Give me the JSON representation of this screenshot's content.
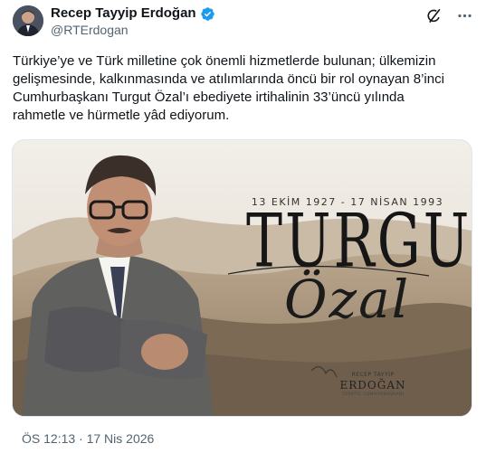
{
  "author": {
    "display_name": "Recep Tayyip Erdoğan",
    "handle": "@RTErdogan",
    "verified_icon": "verified-badge-icon"
  },
  "tweet": {
    "text_lines": [
      "Türkiye’ye ve Türk milletine çok önemli hizmetlerde bulunan; ülkemizin",
      "gelişmesinde, kalkınmasında ve atılımlarında öncü bir rol oynayan 8’inci",
      "Cumhurbaşkanı Turgut Özal’ı ebediyete irtihalinin 33’üncü yılında",
      "rahmetle ve hürmetle yâd ediyorum."
    ],
    "timestamp": "ÖS 12:13 · 17 Nis 2026"
  },
  "media": {
    "dates": "13 EKİM 1927 - 17 NİSAN 1993",
    "first_name": "TURGUT",
    "last_name": "Özal",
    "signature_name": "RECEP TAYYİP",
    "signature_surname": "ERDOĞAN",
    "signature_title": "TÜRKİYE CUMHURBAŞKANI"
  },
  "actions": {
    "grok_icon": "grok-icon",
    "more_icon": "more-options-icon"
  },
  "colors": {
    "verified": "#1d9bf0",
    "secondary_text": "#536471",
    "primary_text": "#0f1419"
  }
}
